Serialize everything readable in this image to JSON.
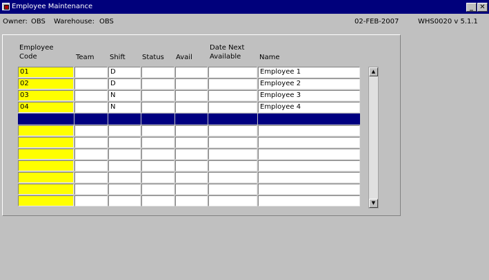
{
  "window": {
    "title": "Employee Maintenance",
    "icon": "oracle-forms-icon",
    "minimize_label": "_",
    "close_label": "✕"
  },
  "info": {
    "owner_label": "Owner:",
    "owner": "OBS",
    "warehouse_label": "Warehouse:",
    "warehouse": "OBS",
    "date": "02-FEB-2007",
    "program": "WHS0020 v 5.1.1"
  },
  "grid": {
    "headers": {
      "code": [
        "Employee",
        "Code"
      ],
      "team": "Team",
      "shift": "Shift",
      "status": "Status",
      "avail": "Avail",
      "date_next": [
        "Date Next",
        "Available"
      ],
      "name": "Name"
    },
    "rows": [
      {
        "code": "01",
        "team": "",
        "shift": "D",
        "status": "",
        "avail": "",
        "date_next": "",
        "name": "Employee 1"
      },
      {
        "code": "02",
        "team": "",
        "shift": "D",
        "status": "",
        "avail": "",
        "date_next": "",
        "name": "Employee 2"
      },
      {
        "code": "03",
        "team": "",
        "shift": "N",
        "status": "",
        "avail": "",
        "date_next": "",
        "name": "Employee 3"
      },
      {
        "code": "04",
        "team": "",
        "shift": "N",
        "status": "",
        "avail": "",
        "date_next": "",
        "name": "Employee 4"
      },
      {
        "code": "",
        "team": "",
        "shift": "",
        "status": "",
        "avail": "",
        "date_next": "",
        "name": "",
        "selected": true
      },
      {
        "code": "",
        "team": "",
        "shift": "",
        "status": "",
        "avail": "",
        "date_next": "",
        "name": ""
      },
      {
        "code": "",
        "team": "",
        "shift": "",
        "status": "",
        "avail": "",
        "date_next": "",
        "name": ""
      },
      {
        "code": "",
        "team": "",
        "shift": "",
        "status": "",
        "avail": "",
        "date_next": "",
        "name": ""
      },
      {
        "code": "",
        "team": "",
        "shift": "",
        "status": "",
        "avail": "",
        "date_next": "",
        "name": ""
      },
      {
        "code": "",
        "team": "",
        "shift": "",
        "status": "",
        "avail": "",
        "date_next": "",
        "name": ""
      },
      {
        "code": "",
        "team": "",
        "shift": "",
        "status": "",
        "avail": "",
        "date_next": "",
        "name": ""
      },
      {
        "code": "",
        "team": "",
        "shift": "",
        "status": "",
        "avail": "",
        "date_next": "",
        "name": ""
      }
    ]
  },
  "scrollbar": {
    "up_icon": "arrow-up-icon",
    "down_icon": "arrow-down-icon",
    "up_glyph": "▲",
    "down_glyph": "▼"
  },
  "colors": {
    "titlebar": "#00007b",
    "required_field": "#ffff00",
    "selected_row": "#000080",
    "background": "#c0c0c0"
  }
}
